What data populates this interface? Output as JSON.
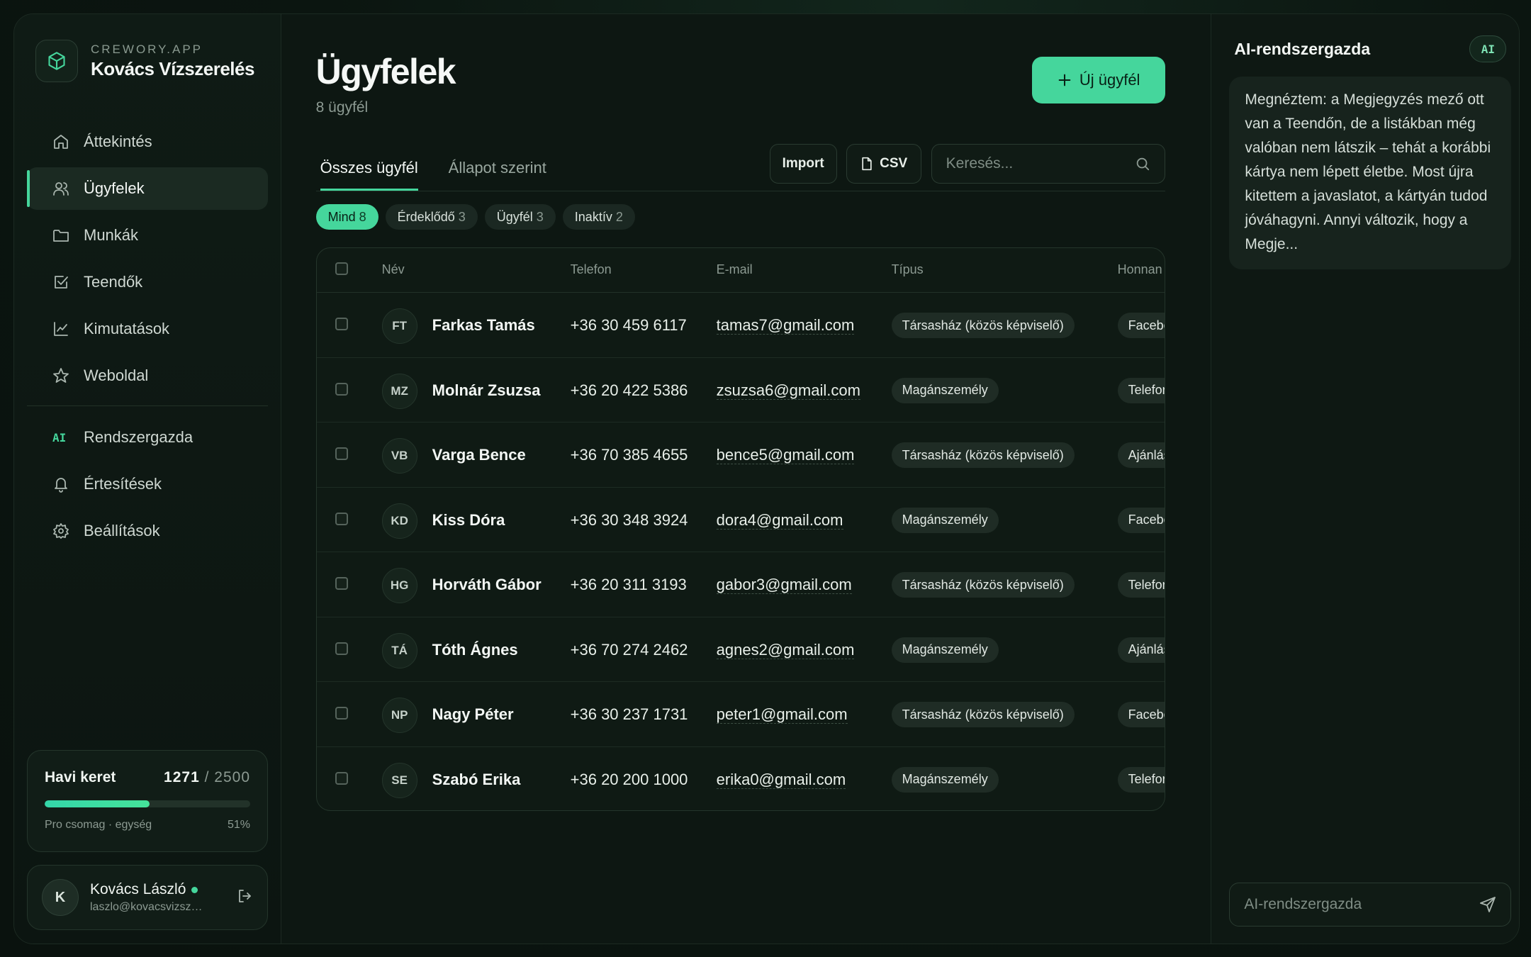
{
  "brand": {
    "subtitle": "CREWORY.APP",
    "name": "Kovács Vízszerelés"
  },
  "nav": {
    "items": [
      {
        "label": "Áttekintés",
        "icon": "home-icon"
      },
      {
        "label": "Ügyfelek",
        "icon": "users-icon",
        "active": true
      },
      {
        "label": "Munkák",
        "icon": "folder-icon"
      },
      {
        "label": "Teendők",
        "icon": "checkbox-icon"
      },
      {
        "label": "Kimutatások",
        "icon": "chart-icon"
      },
      {
        "label": "Weboldal",
        "icon": "star-icon"
      }
    ],
    "secondary": [
      {
        "label": "Rendszergazda",
        "glyph": "AI"
      },
      {
        "label": "Értesítések",
        "icon": "bell-icon"
      },
      {
        "label": "Beállítások",
        "icon": "gear-icon"
      }
    ]
  },
  "quota": {
    "title": "Havi keret",
    "used": "1271",
    "total": "/ 2500",
    "plan": "Pro csomag · egység",
    "percent_label": "51%",
    "fraction": 0.51
  },
  "user": {
    "initial": "K",
    "name": "Kovács László",
    "email": "laszlo@kovacsvizszereles.hu"
  },
  "page": {
    "title": "Ügyfelek",
    "subtitle": "8 ügyfél",
    "new_button": "Új ügyfél"
  },
  "tabs": [
    "Összes ügyfél",
    "Állapot szerint"
  ],
  "toolbar": {
    "import": "Import",
    "csv": "CSV",
    "search_placeholder": "Keresés..."
  },
  "chips": [
    {
      "label": "Mind",
      "count": "8",
      "active": true
    },
    {
      "label": "Érdeklődő",
      "count": "3"
    },
    {
      "label": "Ügyfél",
      "count": "3"
    },
    {
      "label": "Inaktív",
      "count": "2"
    }
  ],
  "table": {
    "headers": {
      "name": "Név",
      "phone": "Telefon",
      "email": "E-mail",
      "type": "Típus",
      "source": "Honnan"
    },
    "rows": [
      {
        "initials": "FT",
        "name": "Farkas Tamás",
        "phone": "+36 30 459 6117",
        "email": "tamas7@gmail.com",
        "type": "Társasház (közös képviselő)",
        "source": "Facebook"
      },
      {
        "initials": "MZ",
        "name": "Molnár Zsuzsa",
        "phone": "+36 20 422 5386",
        "email": "zsuzsa6@gmail.com",
        "type": "Magánszemély",
        "source": "Telefon"
      },
      {
        "initials": "VB",
        "name": "Varga Bence",
        "phone": "+36 70 385 4655",
        "email": "bence5@gmail.com",
        "type": "Társasház (közös képviselő)",
        "source": "Ajánlás"
      },
      {
        "initials": "KD",
        "name": "Kiss Dóra",
        "phone": "+36 30 348 3924",
        "email": "dora4@gmail.com",
        "type": "Magánszemély",
        "source": "Facebook"
      },
      {
        "initials": "HG",
        "name": "Horváth Gábor",
        "phone": "+36 20 311 3193",
        "email": "gabor3@gmail.com",
        "type": "Társasház (közös képviselő)",
        "source": "Telefon"
      },
      {
        "initials": "TÁ",
        "name": "Tóth Ágnes",
        "phone": "+36 70 274 2462",
        "email": "agnes2@gmail.com",
        "type": "Magánszemély",
        "source": "Ajánlás"
      },
      {
        "initials": "NP",
        "name": "Nagy Péter",
        "phone": "+36 30 237 1731",
        "email": "peter1@gmail.com",
        "type": "Társasház (közös képviselő)",
        "source": "Facebook"
      },
      {
        "initials": "SE",
        "name": "Szabó Erika",
        "phone": "+36 20 200 1000",
        "email": "erika0@gmail.com",
        "type": "Magánszemély",
        "source": "Telefon"
      }
    ]
  },
  "ai": {
    "title": "AI-rendszergazda",
    "badge": "AI",
    "message": "Megnéztem: a Megjegyzés mező ott van a Teendőn, de a listákban még valóban nem látszik – tehát a korábbi kártya nem lépett életbe. Most újra kitettem a javaslatot, a kártyán tudod jóváhagyni. Annyi változik, hogy a Megje...",
    "input_placeholder": "AI-rendszergazda"
  },
  "colors": {
    "accent": "#45d69c",
    "background": "#0d1712"
  }
}
